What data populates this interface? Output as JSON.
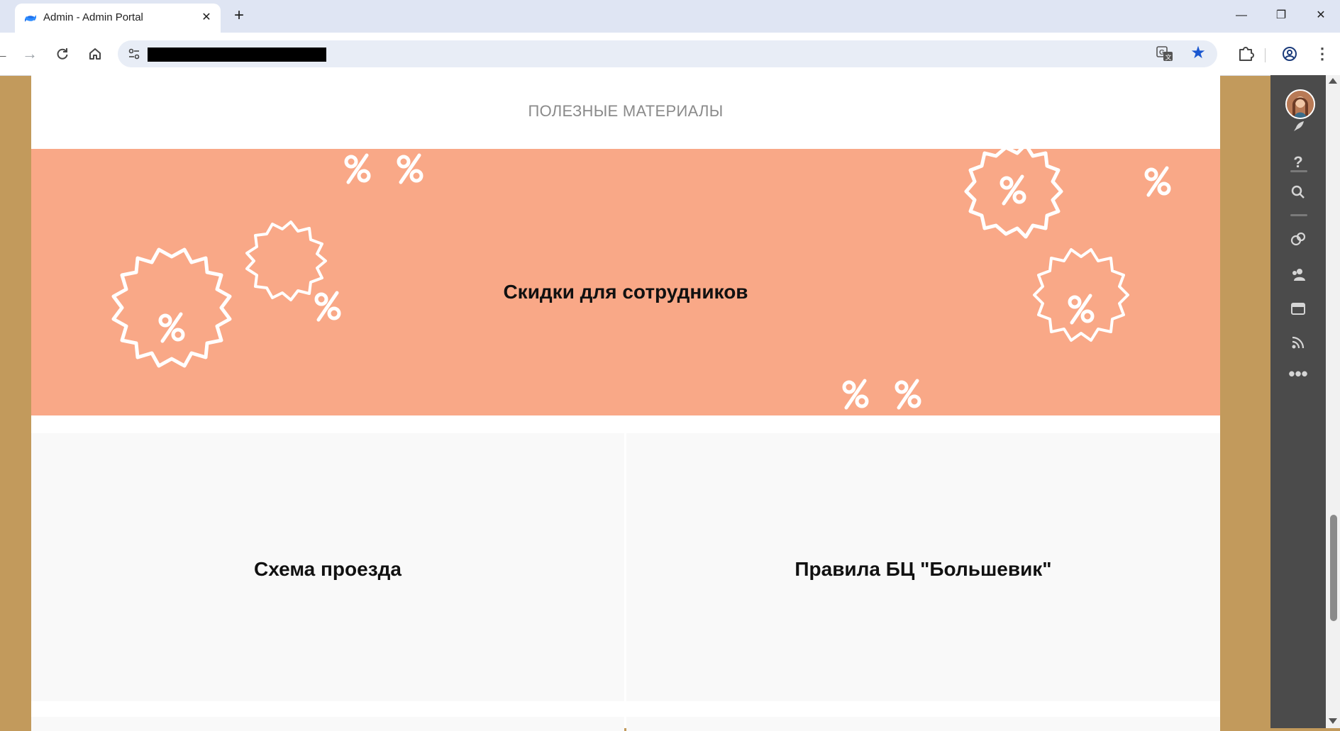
{
  "browser": {
    "tab_title": "Admin - Admin Portal",
    "close_tab_glyph": "✕",
    "new_tab_glyph": "+",
    "window_minimize_glyph": "—",
    "window_restore_glyph": "❐",
    "window_close_glyph": "✕",
    "menu_glyph": "⋮"
  },
  "page": {
    "section_title": "ПОЛЕЗНЫЕ МАТЕРИАЛЫ",
    "banner": {
      "title": "Скидки для сотрудников",
      "background": "#f9a887"
    },
    "tiles": [
      {
        "title": "Схема проезда"
      },
      {
        "title": "Правила БЦ \"Большевик\""
      }
    ]
  },
  "sidebar": {
    "icons": [
      "rocket-icon",
      "help-icon",
      "search-icon",
      "link-icon",
      "people-icon",
      "calendar-icon",
      "feed-icon",
      "more-icon"
    ]
  },
  "colors": {
    "background": "#c29a5c",
    "sidebar": "#4b4b4b",
    "accent": "#1a57d0"
  }
}
